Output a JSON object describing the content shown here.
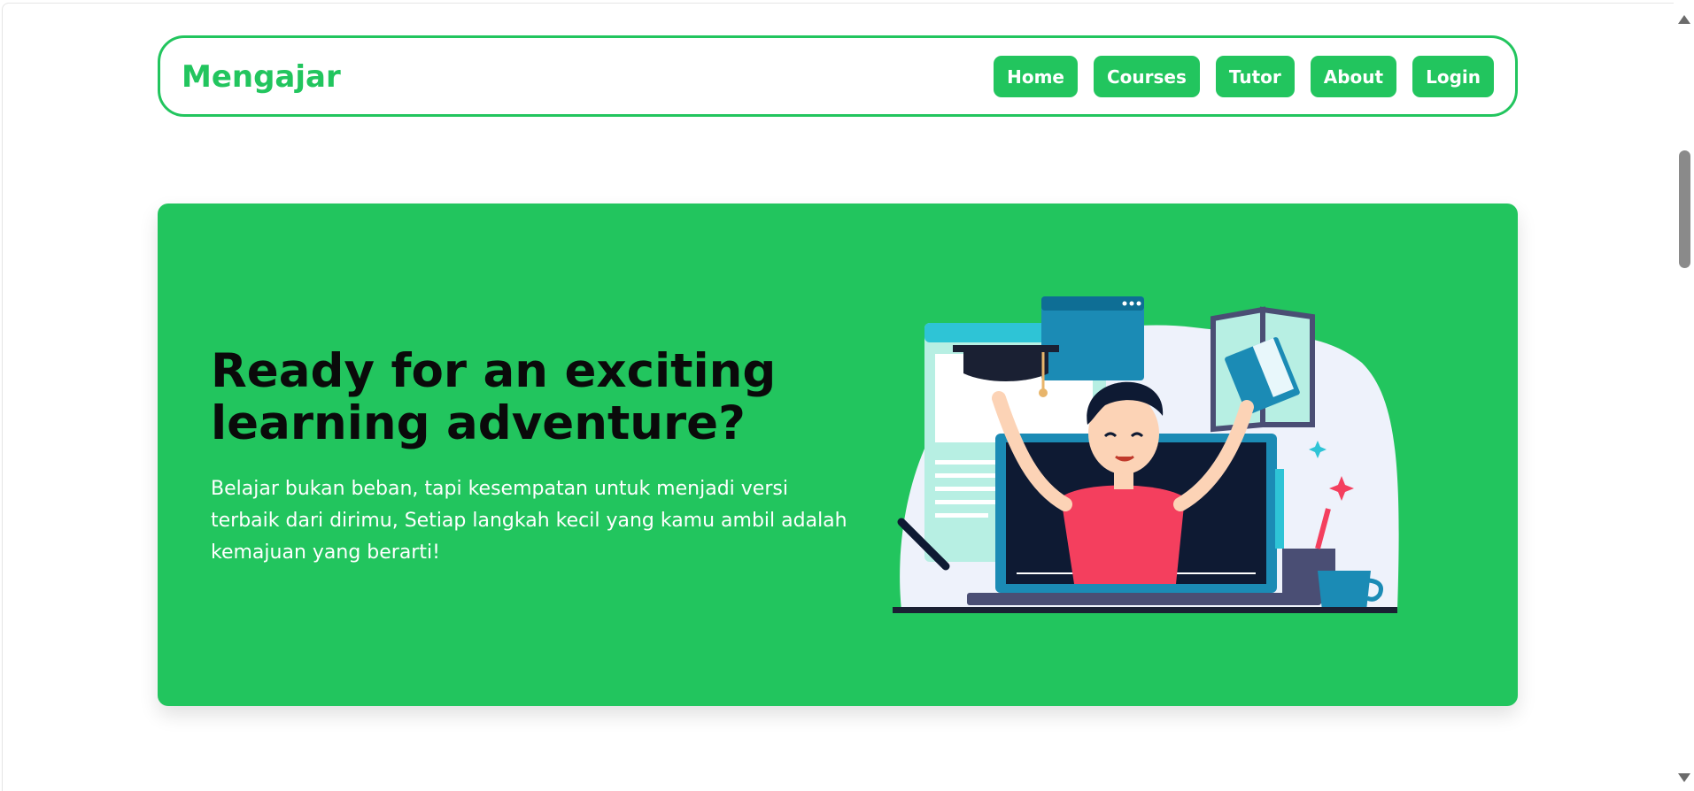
{
  "brand": "Mengajar",
  "nav": {
    "items": [
      "Home",
      "Courses",
      "Tutor",
      "About",
      "Login"
    ]
  },
  "hero": {
    "title": "Ready for an exciting learning adventure?",
    "text": "Belajar bukan beban, tapi kesempatan untuk menjadi versi terbaik dari dirimu, Setiap langkah kecil yang kamu ambil adalah kemajuan yang berarti!"
  },
  "colors": {
    "accent": "#22c55e",
    "title_text": "#0a0a0a",
    "hero_text": "#ffffff"
  }
}
